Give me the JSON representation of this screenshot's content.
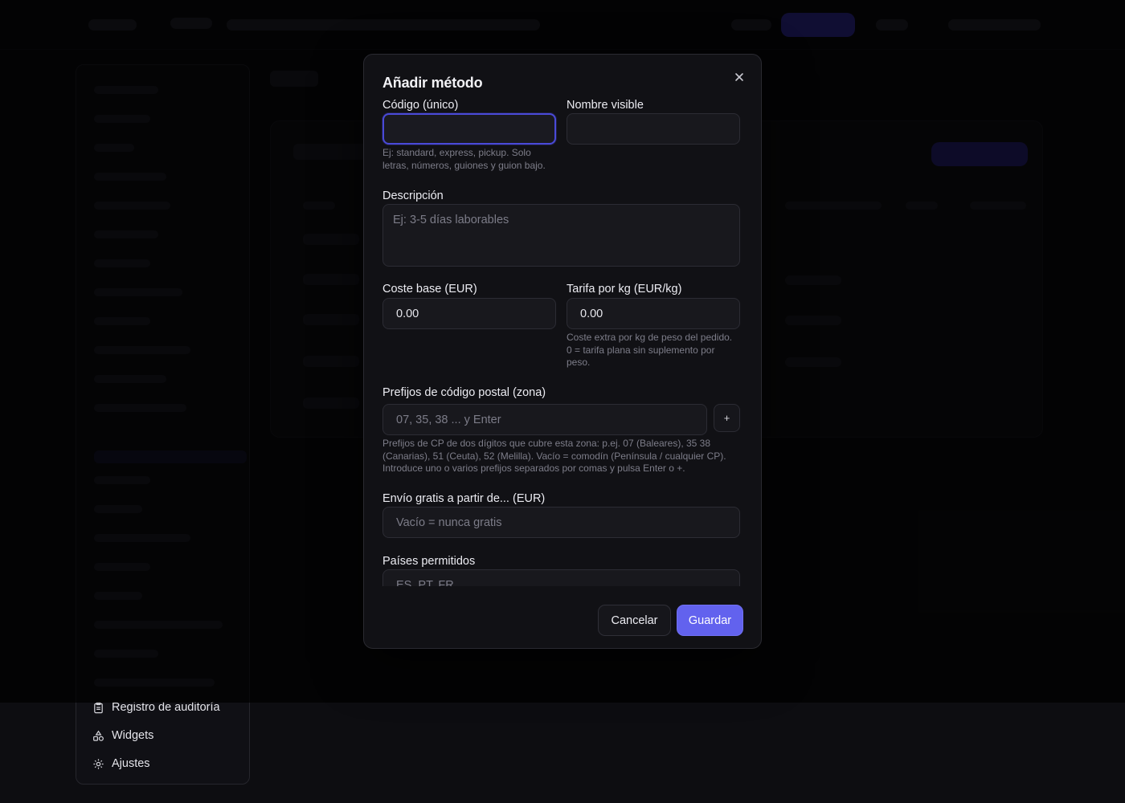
{
  "modal": {
    "title": "Añadir método",
    "close_icon": "close-icon",
    "fields": {
      "code": {
        "label": "Código (único)",
        "value": "",
        "placeholder": "",
        "hint": "Ej: standard, express, pickup. Solo letras, números, guiones y guion bajo."
      },
      "name": {
        "label": "Nombre visible",
        "value": "",
        "placeholder": ""
      },
      "description": {
        "label": "Descripción",
        "placeholder": "Ej: 3-5 días laborables"
      },
      "base_cost": {
        "label": "Coste base (EUR)",
        "value": "0.00"
      },
      "per_kg": {
        "label": "Tarifa por kg (EUR/kg)",
        "value": "0.00",
        "hint": "Coste extra por kg de peso del pedido. 0 = tarifa plana sin suplemento por peso."
      },
      "zip_prefixes": {
        "label": "Prefijos de código postal (zona)",
        "placeholder": "07, 35, 38 ... y Enter",
        "add_label": "+",
        "hint": "Prefijos de CP de dos dígitos que cubre esta zona: p.ej. 07 (Baleares), 35 38 (Canarias), 51 (Ceuta), 52 (Melilla). Vacío = comodín (Península / cualquier CP). Introduce uno o varios prefijos separados por comas y pulsa Enter o +."
      },
      "free_from": {
        "label": "Envío gratis a partir de... (EUR)",
        "placeholder": "Vacío = nunca gratis"
      },
      "countries": {
        "label": "Países permitidos",
        "placeholder": "ES, PT, FR"
      }
    },
    "buttons": {
      "cancel": "Cancelar",
      "save": "Guardar"
    }
  },
  "sidebar": {
    "items": [
      {
        "label": "Registro de auditoría",
        "icon": "clipboard-icon"
      },
      {
        "label": "Widgets",
        "icon": "shapes-icon"
      },
      {
        "label": "Ajustes",
        "icon": "gear-icon"
      }
    ]
  },
  "colors": {
    "accent": "#6262ee",
    "focus_ring": "#4a4ad8",
    "modal_bg": "#111115",
    "input_bg": "#18181d"
  }
}
